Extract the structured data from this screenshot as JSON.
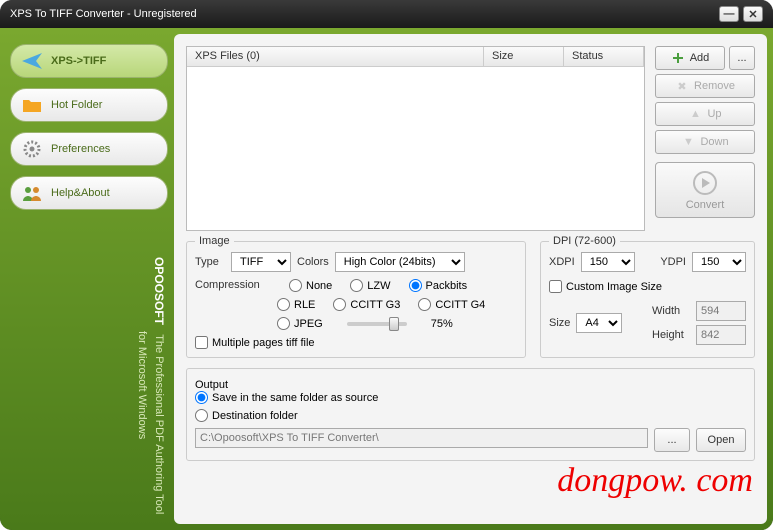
{
  "title": "XPS To TIFF Converter - Unregistered",
  "nav": {
    "xpstiff": "XPS->TIFF",
    "hotfolder": "Hot Folder",
    "preferences": "Preferences",
    "helpabout": "Help&About"
  },
  "vtext_brand": "OPOOSOFT",
  "vtext_line1": "The Professional PDF Authoring Tool",
  "vtext_line2": "for Microsoft Windows",
  "filelist": {
    "col_files": "XPS Files (0)",
    "col_size": "Size",
    "col_status": "Status"
  },
  "actions": {
    "add": "Add",
    "more": "...",
    "remove": "Remove",
    "up": "Up",
    "down": "Down",
    "convert": "Convert"
  },
  "image": {
    "title": "Image",
    "type_label": "Type",
    "type_value": "TIFF",
    "colors_label": "Colors",
    "colors_value": "High Color (24bits)",
    "compression_label": "Compression",
    "none": "None",
    "lzw": "LZW",
    "packbits": "Packbits",
    "rle": "RLE",
    "ccittg3": "CCITT G3",
    "ccittg4": "CCITT G4",
    "jpeg": "JPEG",
    "jpeg_quality": "75%",
    "multipage": "Multiple pages tiff file"
  },
  "dpi": {
    "title": "DPI (72-600)",
    "xdpi_label": "XDPI",
    "xdpi_value": "150",
    "ydpi_label": "YDPI",
    "ydpi_value": "150",
    "custom_label": "Custom Image Size",
    "size_label": "Size",
    "size_value": "A4",
    "width_label": "Width",
    "width_value": "594",
    "height_label": "Height",
    "height_value": "842"
  },
  "output": {
    "title": "Output",
    "same_folder": "Save in the same folder as source",
    "dest_folder": "Destination folder",
    "path": "C:\\Opoosoft\\XPS To TIFF Converter\\",
    "browse": "...",
    "open": "Open"
  },
  "watermark": "dongpow. com"
}
